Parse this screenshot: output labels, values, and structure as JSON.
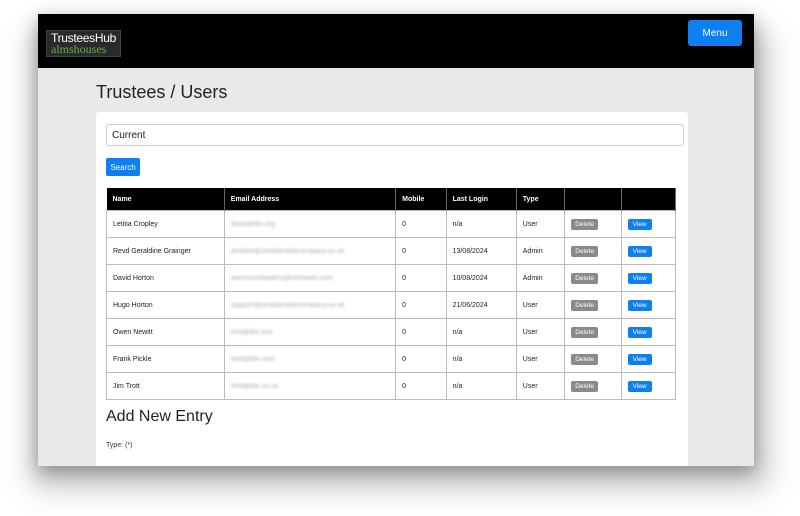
{
  "header": {
    "logo_top": "TrusteesHub",
    "logo_bottom": "almshouses",
    "menu_label": "Menu"
  },
  "page": {
    "title": "Trustees / Users"
  },
  "filter": {
    "value": "Current",
    "search_label": "Search"
  },
  "table": {
    "columns": [
      "Name",
      "Email Address",
      "Mobile",
      "Last Login",
      "Type",
      "",
      ""
    ],
    "delete_label": "Delete",
    "view_label": "View",
    "rows": [
      {
        "name": "Letitia Cropley",
        "email": "hbuk@tbe.org",
        "mobile": "0",
        "last_login": "n/a",
        "type": "User"
      },
      {
        "name": "Revd Geraldine Grainger",
        "email": "andrew@smarterwebcompany.co.uk",
        "mobile": "0",
        "last_login": "13/08/2024",
        "type": "Admin"
      },
      {
        "name": "David Horton",
        "email": "winchcombealms@netowen.com",
        "mobile": "0",
        "last_login": "10/08/2024",
        "type": "Admin"
      },
      {
        "name": "Hugo Horton",
        "email": "support@smarterwebcompany.co.uk",
        "mobile": "0",
        "last_login": "21/06/2024",
        "type": "User"
      },
      {
        "name": "Owen Newitt",
        "email": "fred@tbe.bus",
        "mobile": "0",
        "last_login": "n/a",
        "type": "User"
      },
      {
        "name": "Frank Pickle",
        "email": "fred@tbe.com",
        "mobile": "0",
        "last_login": "n/a",
        "type": "User"
      },
      {
        "name": "Jim Trott",
        "email": "fred@tbe.co.uk",
        "mobile": "0",
        "last_login": "n/a",
        "type": "User"
      }
    ]
  },
  "add_entry": {
    "title": "Add New Entry",
    "type_label": "Type: (*)"
  }
}
